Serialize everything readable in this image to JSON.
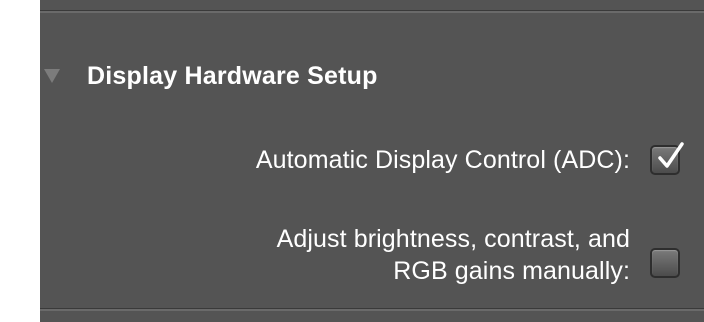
{
  "section": {
    "title": "Display Hardware Setup",
    "expanded": true
  },
  "options": {
    "adc": {
      "label": "Automatic Display Control (ADC):",
      "checked": true
    },
    "manual": {
      "label_line1": "Adjust brightness, contrast, and",
      "label_line2": "RGB gains manually:",
      "checked": false
    }
  },
  "colors": {
    "panel_background": "#545454",
    "text": "#ffffff",
    "disclosure_triangle": "#7c7c7c"
  },
  "icons": {
    "disclosure": "disclosure-triangle-down-icon",
    "checked": "checkmark-icon"
  }
}
